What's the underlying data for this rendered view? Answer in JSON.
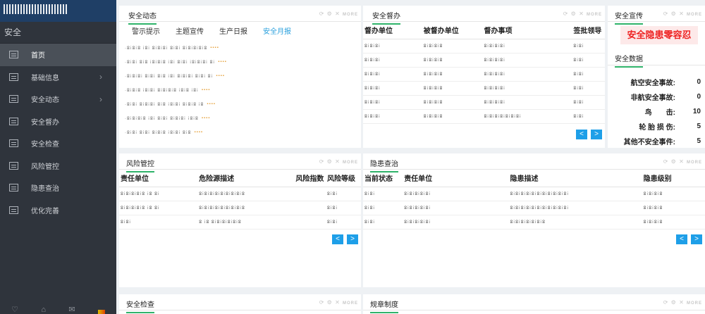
{
  "sidebar": {
    "system": "安全",
    "items": [
      {
        "label": "首页",
        "active": true,
        "arrow": false
      },
      {
        "label": "基础信息",
        "active": false,
        "arrow": true
      },
      {
        "label": "安全动态",
        "active": false,
        "arrow": true
      },
      {
        "label": "安全督办",
        "active": false,
        "arrow": false
      },
      {
        "label": "安全检查",
        "active": false,
        "arrow": false
      },
      {
        "label": "风险管控",
        "active": false,
        "arrow": false
      },
      {
        "label": "隐患查治",
        "active": false,
        "arrow": false
      },
      {
        "label": "优化完善",
        "active": false,
        "arrow": false
      }
    ]
  },
  "panels": {
    "news": {
      "title": "安全动态",
      "tabs": [
        "警示提示",
        "主题宣传",
        "生产日报",
        "安全月报"
      ],
      "active_tab": "安全月报",
      "items": [
        {
          "text": "·ⵓⵂⵓⵂⵓ ⵂⵓⵂ ⵓⵂⵓⵂⵓⵂ ⵓⵂⵓⵂ ⵓⵂⵓⵂⵓⵂⵓⵂⵓ",
          "date": "▪▪▪▪"
        },
        {
          "text": "·ⵓⵂⵓⵂ ⵓⵂⵓ ⵂⵓⵂⵓⵂⵓ ⵂⵓⵂ ⵓⵂⵓⵂ ⵂⵓⵂⵓⵂⵓⵂ ⵓⵂ",
          "date": "▪▪▪▪"
        },
        {
          "text": "·ⵓⵂⵓⵂⵓⵂ ⵓⵂⵓⵂ ⵓⵂⵓ ⵂⵓⵂ ⵓⵂⵓⵂⵓⵂ ⵓⵂⵓⵂ ⵓⵂ",
          "date": "▪▪▪▪"
        },
        {
          "text": "·ⵓⵂⵓⵂⵓ ⵂⵓⵂⵓⵂ ⵓⵂⵓⵂⵓⵂⵓ ⵂⵓⵂⵓ ⵂⵓⵂ",
          "date": "▪▪▪▪"
        },
        {
          "text": "·ⵓⵂⵓⵂ ⵓⵂⵓⵂⵓⵂ ⵓⵂⵓ ⵂⵓⵂⵓⵂ ⵓⵂⵓⵂⵓ ⵂⵓ",
          "date": "▪▪▪▪"
        },
        {
          "text": "·ⵓⵂⵓⵂⵓⵂⵓ ⵂⵓⵂ ⵓⵂⵓⵂ ⵓⵂⵓⵂⵓⵂ ⵂⵓⵂⵓ",
          "date": "▪▪▪▪"
        },
        {
          "text": "·ⵓⵂⵓⵂ ⵓⵂⵓⵂ ⵓⵂⵓⵂⵓ ⵂⵓⵂⵓⵂ ⵓⵂⵓ",
          "date": "▪▪▪▪"
        }
      ]
    },
    "supervise": {
      "title": "安全督办",
      "headers": [
        "督办单位",
        "被督办单位",
        "督办事项",
        "签批领导"
      ],
      "rows": [
        [
          "ⵓⵂⵓⵂⵓⵂ",
          "ⵓⵂⵓⵂⵓⵂⵓ",
          "ⵓⵂⵓⵂⵓⵂⵓⵂ",
          "ⵓⵂⵓⵂ"
        ],
        [
          "ⵓⵂⵓⵂⵓⵂ",
          "ⵓⵂⵓⵂⵓⵂⵓ",
          "ⵓⵂⵓⵂⵓⵂⵓⵂ",
          "ⵓⵂⵓⵂ"
        ],
        [
          "ⵓⵂⵓⵂⵓⵂ",
          "ⵓⵂⵓⵂⵓⵂⵓ",
          "ⵓⵂⵓⵂⵓⵂⵓⵂ",
          "ⵓⵂⵓⵂ"
        ],
        [
          "ⵓⵂⵓⵂⵓⵂ",
          "ⵓⵂⵓⵂⵓⵂⵓ",
          "ⵓⵂⵓⵂⵓⵂⵓⵂ",
          "ⵓⵂⵓⵂ"
        ],
        [
          "ⵓⵂⵓⵂⵓⵂ",
          "ⵓⵂⵓⵂⵓⵂⵓ",
          "ⵓⵂⵓⵂⵓⵂⵓⵂ",
          "ⵓⵂⵓⵂ"
        ],
        [
          "ⵓⵂⵓⵂⵓⵂ",
          "ⵓⵂⵓⵂⵓⵂⵓ",
          "ⵓⵂⵓⵂⵓⵂⵓⵂⵓⵂⵓⵂⵓⵂ",
          "ⵓⵂⵓⵂ"
        ]
      ],
      "prev": "<",
      "next": ">"
    },
    "publicity": {
      "title": "安全宣传",
      "slogan": "安全隐患零容忍"
    },
    "stats": {
      "title": "安全数据",
      "items": [
        {
          "label": "航空安全事故:",
          "value": "0"
        },
        {
          "label": "非航安全事故:",
          "value": "0"
        },
        {
          "label": "鸟　　击:",
          "value": "10"
        },
        {
          "label": "轮 胎 损 伤:",
          "value": "5"
        },
        {
          "label": "其他不安全事件:",
          "value": "5"
        }
      ]
    },
    "risk": {
      "title": "风险管控",
      "headers": [
        "责任单位",
        "危险源描述",
        "风险指数",
        "风险等级"
      ],
      "rows": [
        [
          "ⵓⵂⵓⵂⵓⵂⵓⵂⵓ ⵂⵓ ⵓⵂ",
          "ⵓⵂⵓⵂⵓⵂⵓⵂⵓⵂⵓⵂⵓⵂⵓⵂⵓ",
          "",
          "ⵓⵂⵓⵂ"
        ],
        [
          "ⵓⵂⵓⵂⵓⵂⵓⵂⵓ ⵂⵓ ⵓⵂ",
          "ⵓⵂⵓⵂⵓⵂⵓⵂⵓⵂⵓⵂⵓⵂⵓⵂⵓ",
          "",
          "ⵓⵂⵓⵂ"
        ],
        [
          "ⵓⵂⵓⵂ",
          "ⵓ ⵂⵓ ⵓⵂⵓⵂⵓⵂⵓⵂⵓⵂⵓ",
          "",
          "ⵓⵂⵓⵂ"
        ]
      ],
      "prev": "<",
      "next": ">"
    },
    "hazard": {
      "title": "隐患查治",
      "headers": [
        "当前状态",
        "责任单位",
        "隐患描述",
        "隐患级别"
      ],
      "rows": [
        [
          "ⵓⵂⵓⵂ",
          "ⵓⵂⵓⵂⵓⵂⵓⵂⵓⵂ",
          "ⵓⵂⵓⵂⵓⵂⵓⵂⵓⵂⵓⵂⵓⵂⵓⵂⵓⵂⵓⵂⵓⵂ",
          "ⵓⵂⵓⵂⵓⵂⵓ"
        ],
        [
          "ⵓⵂⵓⵂ",
          "ⵓⵂⵓⵂⵓⵂⵓⵂⵓⵂ",
          "ⵓⵂⵓⵂⵓⵂⵓⵂⵓⵂⵓⵂⵓⵂⵓⵂⵓⵂⵓⵂⵓⵂ",
          "ⵓⵂⵓⵂⵓⵂⵓ"
        ],
        [
          "ⵓⵂⵓⵂ",
          "ⵓⵂⵓⵂⵓⵂⵓⵂⵓⵂ",
          "ⵓⵂⵓⵂⵓⵂⵓⵂⵓⵂⵓⵂⵓ",
          "ⵓⵂⵓⵂⵓⵂⵓ"
        ]
      ],
      "prev": "<",
      "next": ">"
    },
    "inspect": {
      "title": "安全检查"
    },
    "rules": {
      "title": "规章制度"
    }
  },
  "tools_label": "MORE",
  "colors": {
    "accent": "#2fb36a",
    "tab_active": "#2aa0dd",
    "pager": "#1e9fe8",
    "slogan": "#ee2222",
    "sidebar": "#2f343c",
    "brand": "#1f3f66"
  }
}
